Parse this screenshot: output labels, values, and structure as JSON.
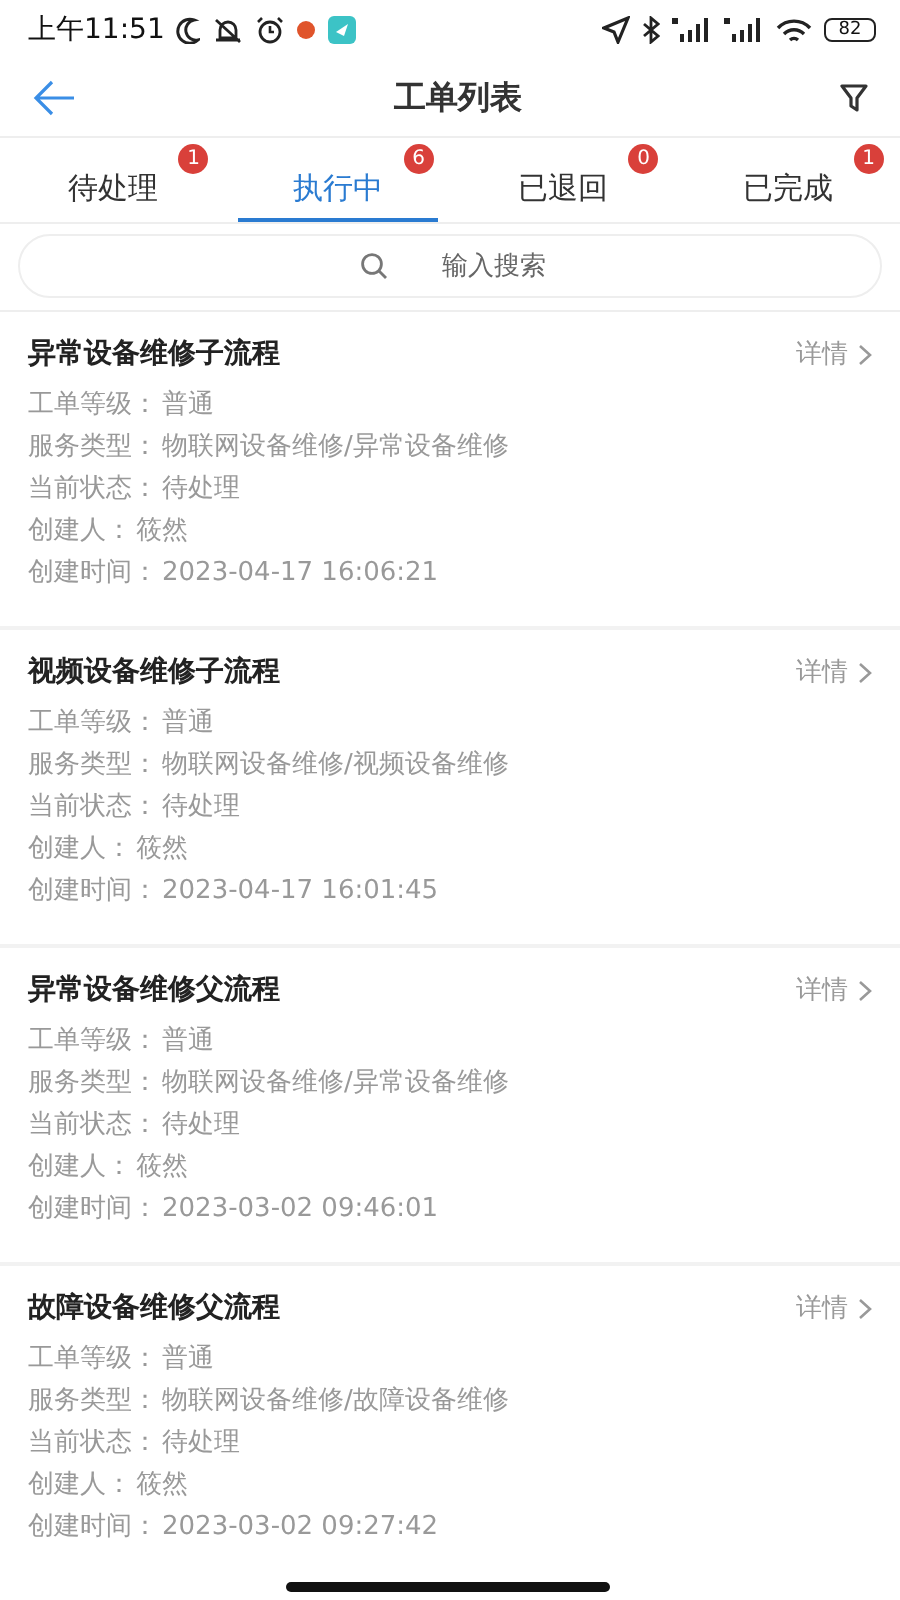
{
  "status_bar": {
    "time": "上午11:51",
    "battery": "82"
  },
  "header": {
    "title": "工单列表"
  },
  "tabs": [
    {
      "label": "待处理",
      "count": "1",
      "selected": false
    },
    {
      "label": "执行中",
      "count": "6",
      "selected": true
    },
    {
      "label": "已退回",
      "count": "0",
      "selected": false
    },
    {
      "label": "已完成",
      "count": "1",
      "selected": false
    }
  ],
  "search": {
    "placeholder": "输入搜索"
  },
  "orders": [
    {
      "title": "异常设备维修子流程",
      "detail": "详情",
      "fields": [
        {
          "label": "工单等级：",
          "value": "普通"
        },
        {
          "label": "服务类型：",
          "value": "物联网设备维修/异常设备维修"
        },
        {
          "label": "当前状态：",
          "value": "待处理"
        },
        {
          "label": "创建人：",
          "value": "筱然"
        },
        {
          "label": "创建时间：",
          "value": "2023-04-17 16:06:21"
        }
      ]
    },
    {
      "title": "视频设备维修子流程",
      "detail": "详情",
      "fields": [
        {
          "label": "工单等级：",
          "value": "普通"
        },
        {
          "label": "服务类型：",
          "value": "物联网设备维修/视频设备维修"
        },
        {
          "label": "当前状态：",
          "value": "待处理"
        },
        {
          "label": "创建人：",
          "value": "筱然"
        },
        {
          "label": "创建时间：",
          "value": "2023-04-17 16:01:45"
        }
      ]
    },
    {
      "title": "异常设备维修父流程",
      "detail": "详情",
      "fields": [
        {
          "label": "工单等级：",
          "value": "普通"
        },
        {
          "label": "服务类型：",
          "value": "物联网设备维修/异常设备维修"
        },
        {
          "label": "当前状态：",
          "value": "待处理"
        },
        {
          "label": "创建人：",
          "value": "筱然"
        },
        {
          "label": "创建时间：",
          "value": "2023-03-02 09:46:01"
        }
      ]
    },
    {
      "title": "故障设备维修父流程",
      "detail": "详情",
      "fields": [
        {
          "label": "工单等级：",
          "value": "普通"
        },
        {
          "label": "服务类型：",
          "value": "物联网设备维修/故障设备维修"
        },
        {
          "label": "当前状态：",
          "value": "待处理"
        },
        {
          "label": "创建人：",
          "value": "筱然"
        },
        {
          "label": "创建时间：",
          "value": "2023-03-02 09:27:42"
        }
      ]
    }
  ]
}
